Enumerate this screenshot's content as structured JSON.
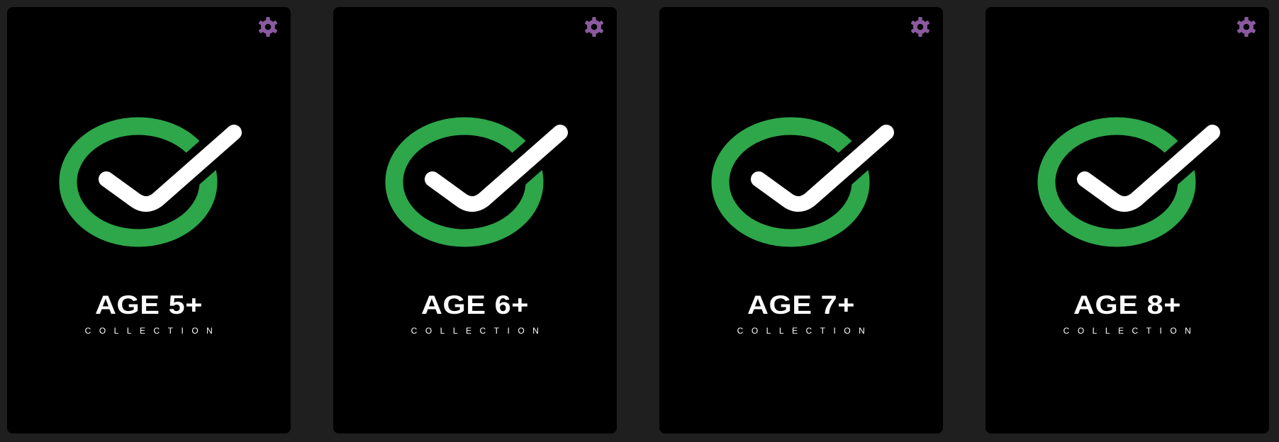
{
  "colors": {
    "background": "#1f1f1f",
    "card": "#000000",
    "ring": "#2ea64a",
    "check": "#ffffff",
    "gear": "#8a5a9e"
  },
  "cards": [
    {
      "title": "AGE 5+",
      "subtitle": "COLLECTION",
      "settings_icon": "gear-icon",
      "logo_icon": "check-circle-icon"
    },
    {
      "title": "AGE 6+",
      "subtitle": "COLLECTION",
      "settings_icon": "gear-icon",
      "logo_icon": "check-circle-icon"
    },
    {
      "title": "AGE 7+",
      "subtitle": "COLLECTION",
      "settings_icon": "gear-icon",
      "logo_icon": "check-circle-icon"
    },
    {
      "title": "AGE 8+",
      "subtitle": "COLLECTION",
      "settings_icon": "gear-icon",
      "logo_icon": "check-circle-icon"
    }
  ]
}
